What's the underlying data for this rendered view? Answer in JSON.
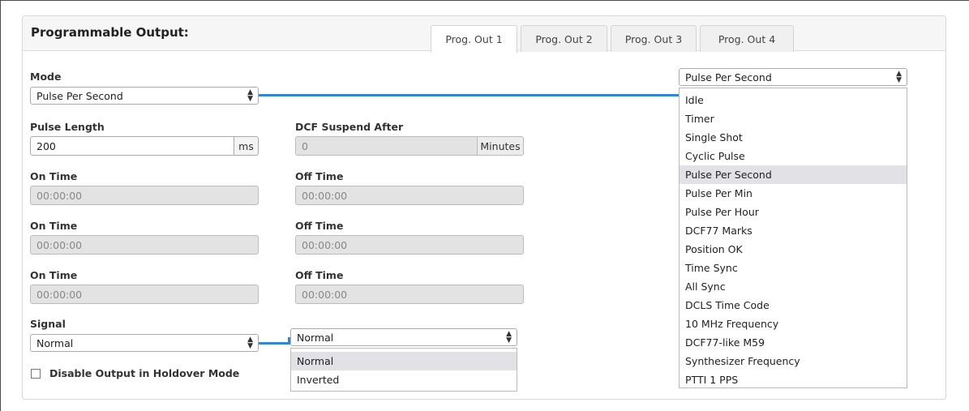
{
  "panel": {
    "title": "Programmable Output:"
  },
  "tabs": [
    {
      "label": "Prog. Out 1",
      "active": true
    },
    {
      "label": "Prog. Out 2",
      "active": false
    },
    {
      "label": "Prog. Out 3",
      "active": false
    },
    {
      "label": "Prog. Out 4",
      "active": false
    }
  ],
  "mode": {
    "label": "Mode",
    "value": "Pulse Per Second",
    "dropdown_value": "Pulse Per Second",
    "options": [
      "Idle",
      "Timer",
      "Single Shot",
      "Cyclic Pulse",
      "Pulse Per Second",
      "Pulse Per Min",
      "Pulse Per Hour",
      "DCF77 Marks",
      "Position OK",
      "Time Sync",
      "All Sync",
      "DCLS Time Code",
      "10 MHz Frequency",
      "DCF77-like M59",
      "Synthesizer Frequency",
      "PTTI 1 PPS"
    ],
    "selected_option": "Pulse Per Second"
  },
  "pulse_length": {
    "label": "Pulse Length",
    "value": "200",
    "unit": "ms"
  },
  "dcf_suspend": {
    "label": "DCF Suspend After",
    "value": "0",
    "unit": "Minutes"
  },
  "time_rows": [
    {
      "on_label": "On Time",
      "on_value": "00:00:00",
      "off_label": "Off Time",
      "off_value": "00:00:00"
    },
    {
      "on_label": "On Time",
      "on_value": "00:00:00",
      "off_label": "Off Time",
      "off_value": "00:00:00"
    },
    {
      "on_label": "On Time",
      "on_value": "00:00:00",
      "off_label": "Off Time",
      "off_value": "00:00:00"
    }
  ],
  "signal": {
    "label": "Signal",
    "value": "Normal",
    "dropdown_value": "Normal",
    "options": [
      "Normal",
      "Inverted"
    ],
    "selected_option": "Normal"
  },
  "holdover": {
    "label": "Disable Output in Holdover Mode",
    "checked": false
  },
  "colors": {
    "connector": "#2f87d9",
    "selected_option_bg": "#e1e1e6",
    "disabled_input_bg": "#e3e3e3"
  }
}
